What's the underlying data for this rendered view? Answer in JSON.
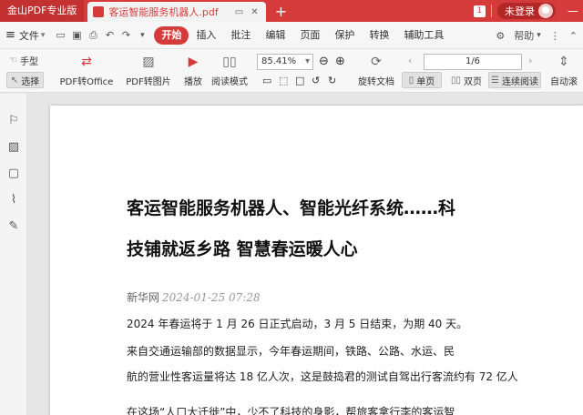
{
  "titlebar": {
    "app_name": "金山PDF专业版",
    "tab_title": "客运智能服务机器人.pdf",
    "new_tab": "+",
    "page_badge": "1",
    "login_label": "未登录",
    "minimize": "—"
  },
  "menubar": {
    "file_label": "文件",
    "items": [
      "开始",
      "插入",
      "批注",
      "编辑",
      "页面",
      "保护",
      "转换",
      "辅助工具"
    ],
    "active_index": 0,
    "help_label": "帮助"
  },
  "toolbar": {
    "hand_label": "手型",
    "select_label": "选择",
    "pdf_to_office": "PDF转Office",
    "pdf_to_image": "PDF转图片",
    "play_label": "播放",
    "read_mode": "阅读模式",
    "zoom_value": "85.41%",
    "rotate_doc": "旋转文档",
    "page_indicator": "1/6",
    "single_page": "单页",
    "double_page": "双页",
    "continuous_read": "连续阅读",
    "auto_scroll": "自动滚"
  },
  "document": {
    "headline_line1": "客运智能服务机器人、智能光纤系统……科",
    "headline_line2": "技铺就返乡路 智慧春运暖人心",
    "source_name": "新华网",
    "source_time": "2024-01-25 07:28",
    "para1": "2024 年春运将于 1 月 26 日正式启动，3 月 5 日结束，为期 40 天。",
    "para2": "来自交通运输部的数据显示，今年春运期间，铁路、公路、水运、民",
    "para3": "航的营业性客运量将达 18 亿人次，这是鼓捣君的测试自驾出行客流约有 72 亿人",
    "para4": "在这场“人口大迁徙”中，少不了科技的身影，帮旅客拿行李的客运智"
  },
  "colors": {
    "accent": "#d63b3b"
  }
}
